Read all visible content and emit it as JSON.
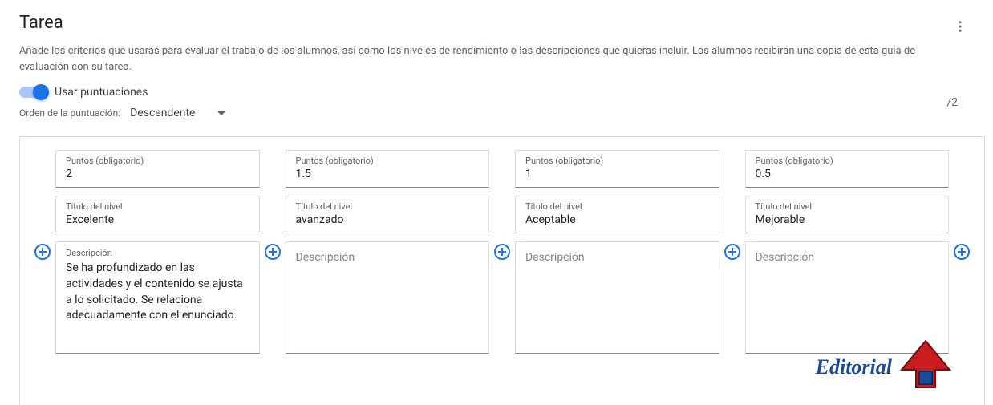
{
  "header": {
    "title": "Tarea",
    "subtitle": "Añade los criterios que usarás para evaluar el trabajo de los alumnos, así como los niveles de rendimiento o las descripciones que quieras incluir. Los alumnos recibirán una copia de esta guía de evaluación con su tarea."
  },
  "controls": {
    "toggle_label": "Usar puntuaciones",
    "toggle_on": true,
    "order_label": "Orden de la puntuación:",
    "order_value": "Descendente",
    "total_score": "/2"
  },
  "labels": {
    "points": "Puntos (obligatorio)",
    "level_title": "Título del nivel",
    "description": "Descripción"
  },
  "levels": [
    {
      "points": "2",
      "title": "Excelente",
      "description": "Se ha profundizado en las actividades y el contenido se ajusta a lo solicitado. Se relaciona adecuadamente con el enunciado."
    },
    {
      "points": "1.5",
      "title": "avanzado",
      "description": ""
    },
    {
      "points": "1",
      "title": "Aceptable",
      "description": ""
    },
    {
      "points": "0.5",
      "title": "Mejorable",
      "description": ""
    }
  ],
  "watermark": {
    "text": "Editorial"
  }
}
